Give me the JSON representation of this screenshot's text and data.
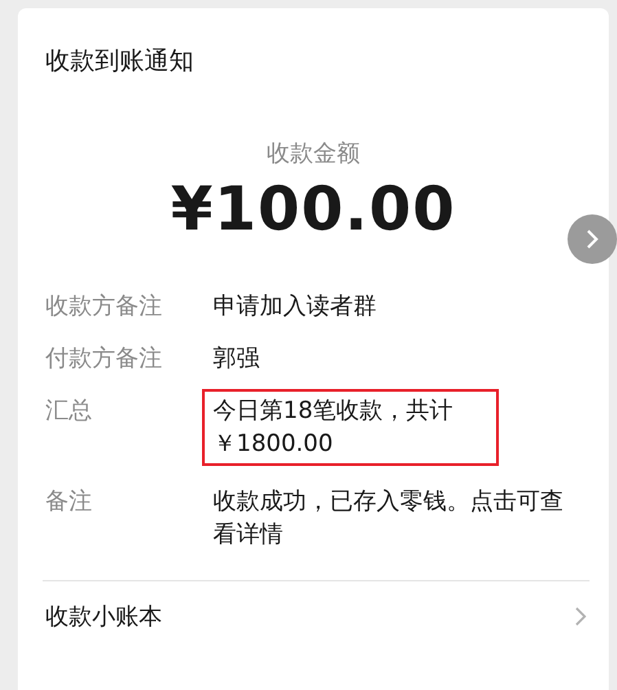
{
  "card": {
    "title": "收款到账通知",
    "amount_label": "收款金额",
    "amount": "¥100.00",
    "rows": [
      {
        "label": "收款方备注",
        "value": "申请加入读者群",
        "highlighted": false
      },
      {
        "label": "付款方备注",
        "value": "郭强",
        "highlighted": false
      },
      {
        "label": "汇总",
        "value": "今日第18笔收款，共计￥1800.00",
        "highlighted": true
      },
      {
        "label": "备注",
        "value": "收款成功，已存入零钱。点击可查看详情",
        "highlighted": false
      }
    ],
    "footer_link": "收款小账本"
  }
}
